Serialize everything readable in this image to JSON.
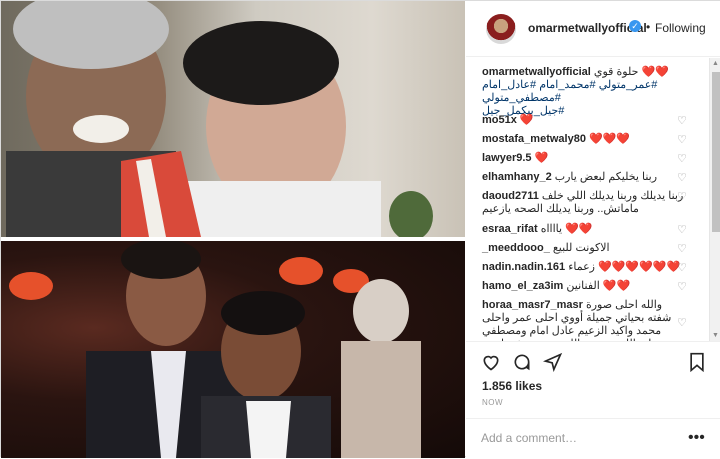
{
  "header": {
    "username": "omarmetwallyofficial",
    "follow_label": "Following",
    "dot": "•"
  },
  "caption": {
    "username": "omarmetwallyofficial",
    "text": "حلوة قوي ❤️❤️",
    "hashtags_line1": "#عمر_متولي #محمد_امام #عادل_امام #مصطفي_متولي",
    "hashtags_line2": "#جيل_بيكمل_جيل"
  },
  "comments": [
    {
      "user": "mo51x",
      "text": "❤️"
    },
    {
      "user": "mostafa_metwaly80",
      "text": "❤️❤️❤️"
    },
    {
      "user": "lawyer9.5",
      "text": "❤️"
    },
    {
      "user": "elhamhany_2",
      "text": "ربنا يخليكم لبعض يارب"
    },
    {
      "user": "daoud2711",
      "text": "ربنا يديلك وربنا يديلك اللي خلف ماماتش.. وربنا يديلك الصحه يازعيم"
    },
    {
      "user": "esraa_rifat",
      "text": "يااااه ❤️❤️"
    },
    {
      "user": "_meeddooo_",
      "text": "الاكونت للبيع"
    },
    {
      "user": "nadin.nadin.161",
      "text": "زعماء ❤️❤️❤️❤️❤️❤️"
    },
    {
      "user": "hamo_el_za3im",
      "text": "الفنانين ❤️❤️"
    },
    {
      "user": "horaa_masr7_masr",
      "text": "والله احلى صورة شفته بحياتي جميلة أووي احلى عمر واحلى محمد واكيد الزعيم عادل امام ومصطفي متولي الله يرحمة والله صورة تحفة ياعمر"
    }
  ],
  "actions": {
    "likes": "1.856 likes",
    "time": "NOW",
    "add_comment_placeholder": "Add a comment…",
    "more_glyph": "•••"
  },
  "icons": {
    "heart": "heart-outline-icon",
    "comment": "comment-bubble-icon",
    "share": "share-paper-plane-icon",
    "save": "bookmark-icon"
  },
  "colors": {
    "link": "#003569",
    "verified": "#3897f0",
    "muted": "#999999"
  }
}
